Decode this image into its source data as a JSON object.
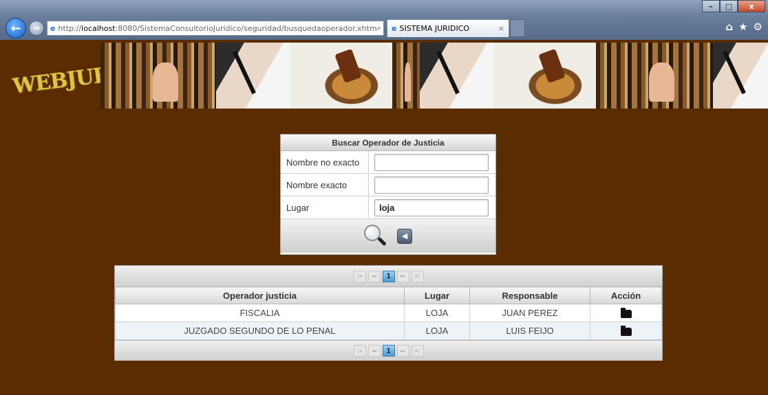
{
  "browser": {
    "address_prefix": "http://",
    "address_host": "localhost",
    "address_rest": ":8080/SistemaConsultorioJuridico/seguridad/busquedaoperador.xhtm",
    "address_controls": "⌕ ▾ ☰ ↻ ✕",
    "tab_title": "SISTEMA JURIDICO",
    "tab_close": "×",
    "window_controls": [
      "–",
      "□",
      "x"
    ],
    "icons": [
      "home-icon",
      "favorites-icon",
      "tools-icon"
    ]
  },
  "site": {
    "logo": "WEBJURIS"
  },
  "search": {
    "title": "Buscar Operador de Justicia",
    "fields": [
      {
        "label": "Nombre no exacto",
        "value": ""
      },
      {
        "label": "Nombre exacto",
        "value": ""
      },
      {
        "label": "Lugar",
        "value": "loja"
      }
    ]
  },
  "pager": {
    "first": "|◂",
    "prev": "◂◂",
    "current": "1",
    "next": "▸▸",
    "last": "▸|"
  },
  "results": {
    "headers": [
      "Operador justicia",
      "Lugar",
      "Responsable",
      "Acción"
    ],
    "rows": [
      {
        "operador": "FISCALIA",
        "lugar": "LOJA",
        "responsable": "JUAN PEREZ"
      },
      {
        "operador": "JUZGADO SEGUNDO DE LO PENAL",
        "lugar": "LOJA",
        "responsable": "LUIS FEIJO"
      }
    ]
  },
  "colors": {
    "page_background": "#5a2c00",
    "logo": "#e0c244",
    "pager_current": "#4d9ed3"
  }
}
